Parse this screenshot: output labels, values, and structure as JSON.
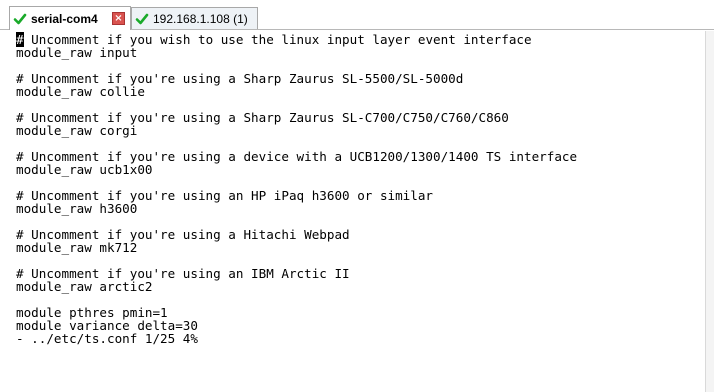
{
  "tabs": [
    {
      "label": "serial-com4",
      "status_icon": "check-icon",
      "close_icon": "close-icon"
    },
    {
      "label": "192.168.1.108 (1)",
      "status_icon": "check-icon"
    }
  ],
  "colors": {
    "check": "#1aaa2a",
    "close": "#d9534f",
    "tab_border": "#a8a8a8"
  },
  "terminal": {
    "cursor_char": "#",
    "lines": [
      " Uncomment if you wish to use the linux input layer event interface",
      "module_raw input",
      "",
      "# Uncomment if you're using a Sharp Zaurus SL-5500/SL-5000d",
      "module_raw collie",
      "",
      "# Uncomment if you're using a Sharp Zaurus SL-C700/C750/C760/C860",
      "module_raw corgi",
      "",
      "# Uncomment if you're using a device with a UCB1200/1300/1400 TS interface",
      "module_raw ucb1x00",
      "",
      "# Uncomment if you're using an HP iPaq h3600 or similar",
      "module_raw h3600",
      "",
      "# Uncomment if you're using a Hitachi Webpad",
      "module_raw mk712",
      "",
      "# Uncomment if you're using an IBM Arctic II",
      "module_raw arctic2",
      "",
      "module pthres pmin=1",
      "module variance delta=30",
      "- ../etc/ts.conf 1/25 4%"
    ]
  }
}
